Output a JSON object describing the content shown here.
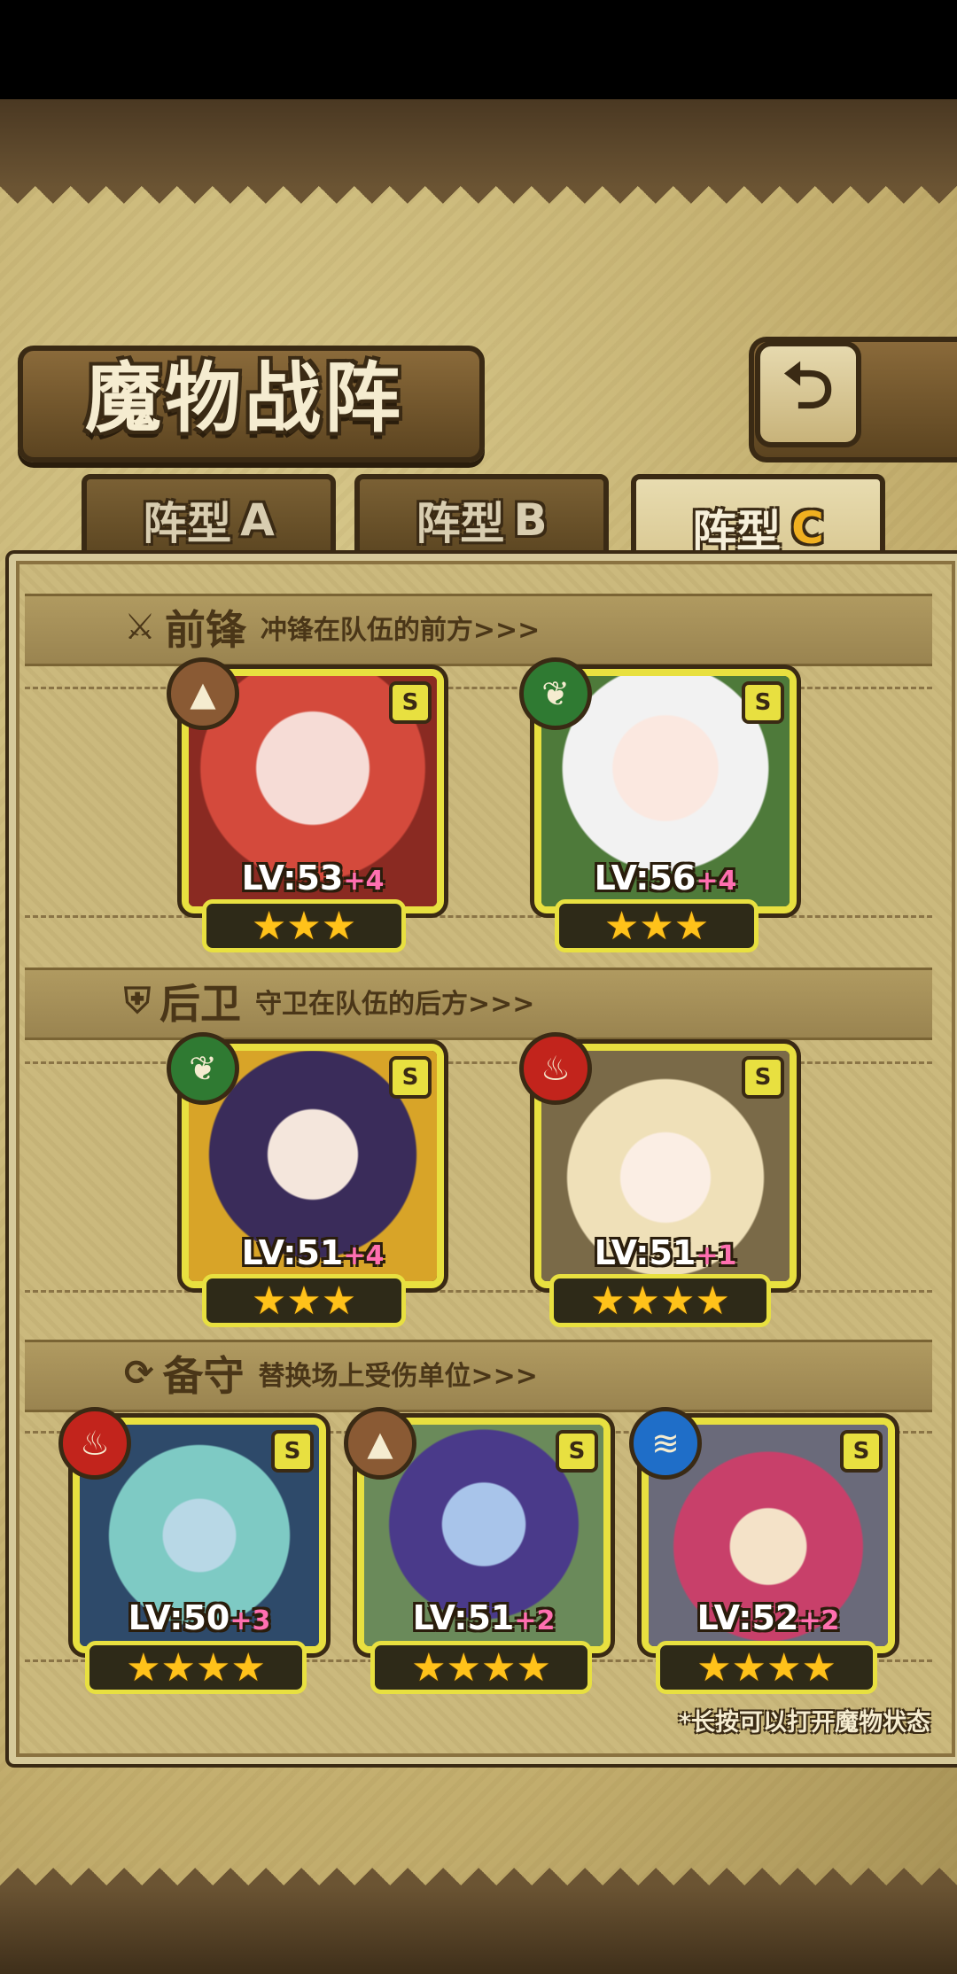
{
  "header": {
    "title": "魔物战阵",
    "back_icon": "return-arrow-icon"
  },
  "tabs": [
    {
      "label": "阵型",
      "suffix": "A",
      "active": false
    },
    {
      "label": "阵型",
      "suffix": "B",
      "active": false
    },
    {
      "label": "阵型",
      "suffix": "C",
      "active": true
    }
  ],
  "sections": {
    "front": {
      "title": "前锋",
      "subtitle": "冲锋在队伍的前方>>>",
      "icon": "sword-icon"
    },
    "rear": {
      "title": "后卫",
      "subtitle": "守卫在队伍的后方>>>",
      "icon": "shield-icon"
    },
    "reserve": {
      "title": "备守",
      "subtitle": "替换场上受伤单位>>>",
      "icon": "swap-icon"
    }
  },
  "monsters": {
    "front": [
      {
        "lv": "LV:53",
        "plus": "+4",
        "grade": "S",
        "element": "earth",
        "stars": 3
      },
      {
        "lv": "LV:56",
        "plus": "+4",
        "grade": "S",
        "element": "wood",
        "stars": 3
      }
    ],
    "rear": [
      {
        "lv": "LV:51",
        "plus": "+4",
        "grade": "S",
        "element": "wood",
        "stars": 3
      },
      {
        "lv": "LV:51",
        "plus": "+1",
        "grade": "S",
        "element": "fire",
        "stars": 4
      }
    ],
    "reserve": [
      {
        "lv": "LV:50",
        "plus": "+3",
        "grade": "S",
        "element": "fire",
        "stars": 4
      },
      {
        "lv": "LV:51",
        "plus": "+2",
        "grade": "S",
        "element": "earth",
        "stars": 4
      },
      {
        "lv": "LV:52",
        "plus": "+2",
        "grade": "S",
        "element": "water",
        "stars": 4
      }
    ]
  },
  "hint": "*长按可以打开魔物状态",
  "colors": {
    "card_border": "#e8e040",
    "star": "#ffc21a",
    "plus_level": "#ff6fb0",
    "tab_accent": "#f0b020"
  }
}
